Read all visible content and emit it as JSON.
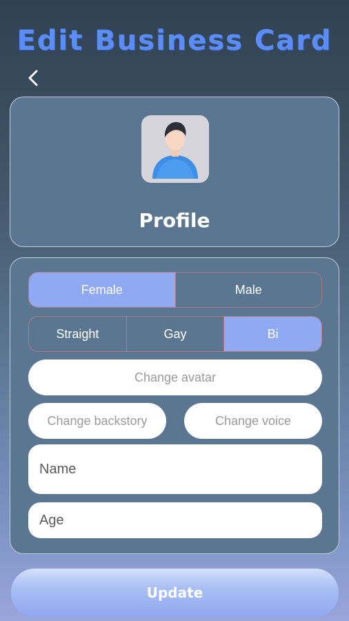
{
  "header": {
    "title": "Edit Business Card",
    "back_icon": "chevron-left-icon"
  },
  "profile": {
    "avatar_icon": "person-avatar-icon",
    "label": "Profile"
  },
  "form": {
    "gender_options": [
      {
        "label": "Female",
        "selected": true
      },
      {
        "label": "Male",
        "selected": false
      }
    ],
    "orientation_options": [
      {
        "label": "Straight",
        "selected": false
      },
      {
        "label": "Gay",
        "selected": false
      },
      {
        "label": "Bi",
        "selected": true
      }
    ],
    "change_avatar_label": "Change avatar",
    "change_backstory_label": "Change backstory",
    "change_voice_label": "Change voice",
    "name_placeholder": "Name",
    "age_placeholder": "Age"
  },
  "update_label": "Update",
  "colors": {
    "title": "#5b8df5",
    "selected_segment": "#8fa9f2",
    "card": "#5a7691",
    "segment_border": "#b07a86"
  }
}
